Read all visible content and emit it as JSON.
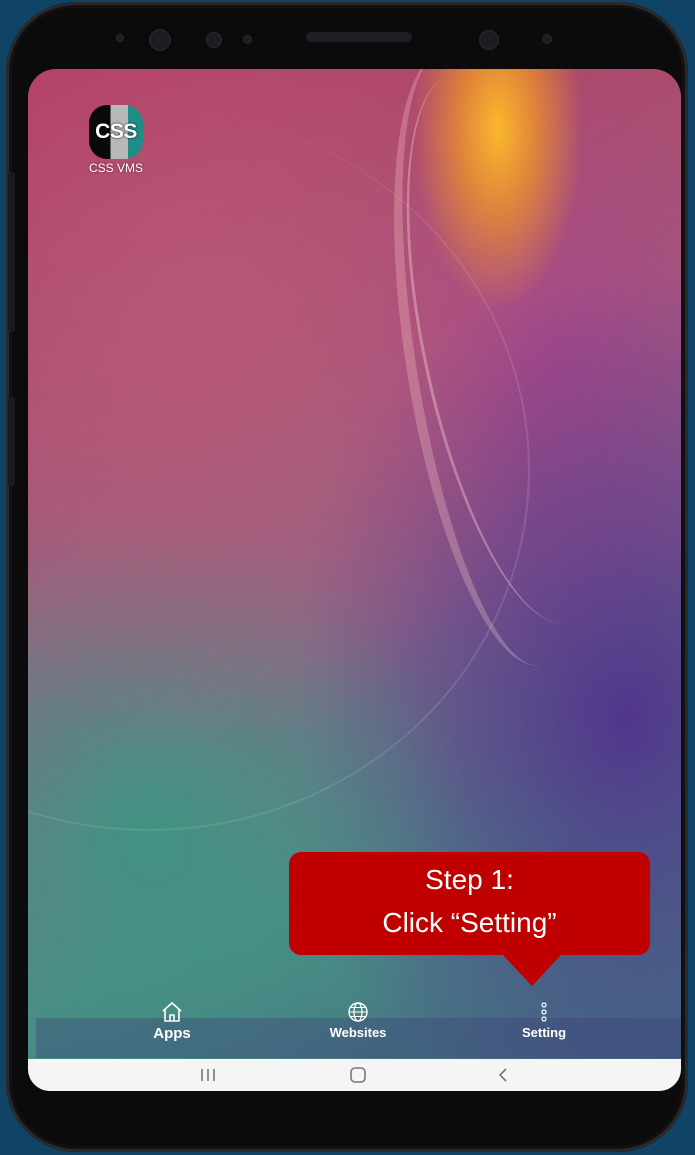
{
  "home_screen": {
    "app_icon": {
      "text": "CSS",
      "label": "CSS VMS"
    }
  },
  "callout": {
    "line1": "Step 1:",
    "line2": "Click “Setting”",
    "color": "#c00000"
  },
  "dock": {
    "items": [
      {
        "label": "Apps",
        "icon": "home-icon"
      },
      {
        "label": "Websites",
        "icon": "globe-icon"
      },
      {
        "label": "Setting",
        "icon": "more-vertical-icon"
      }
    ]
  },
  "navbar": {
    "buttons": [
      "recent-apps-icon",
      "home-button-icon",
      "back-icon"
    ]
  }
}
